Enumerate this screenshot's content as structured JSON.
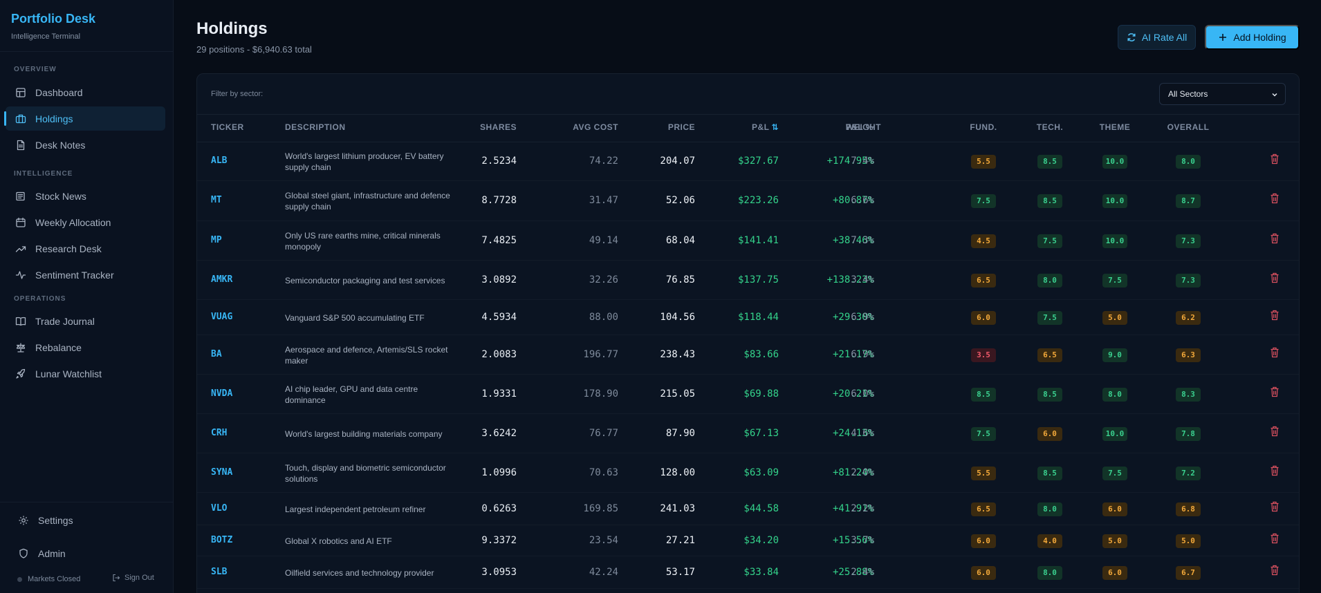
{
  "app": {
    "title": "Portfolio Desk",
    "subtitle": "Intelligence Terminal"
  },
  "sidebar": {
    "sections": [
      {
        "label": "OVERVIEW",
        "items": [
          {
            "label": "Dashboard",
            "icon": "grid-icon",
            "active": false
          },
          {
            "label": "Holdings",
            "icon": "briefcase-icon",
            "active": true
          },
          {
            "label": "Desk Notes",
            "icon": "document-icon",
            "active": false
          }
        ]
      },
      {
        "label": "INTELLIGENCE",
        "items": [
          {
            "label": "Stock News",
            "icon": "newspaper-icon",
            "active": false
          },
          {
            "label": "Weekly Allocation",
            "icon": "calendar-icon",
            "active": false
          },
          {
            "label": "Research Desk",
            "icon": "trend-icon",
            "active": false
          },
          {
            "label": "Sentiment Tracker",
            "icon": "pulse-icon",
            "active": false
          }
        ]
      },
      {
        "label": "OPERATIONS",
        "items": [
          {
            "label": "Trade Journal",
            "icon": "book-icon",
            "active": false
          },
          {
            "label": "Rebalance",
            "icon": "scale-icon",
            "active": false
          },
          {
            "label": "Lunar Watchlist",
            "icon": "rocket-icon",
            "active": false
          }
        ]
      }
    ],
    "settings_label": "Settings",
    "admin_label": "Admin",
    "market_status": "Markets Closed",
    "signout_label": "Sign Out"
  },
  "header": {
    "title": "Holdings",
    "subtitle": "29 positions - $6,940.63 total",
    "rate_button": "AI Rate All",
    "add_button": "Add Holding"
  },
  "filter": {
    "label": "Filter by sector:",
    "selected": "All Sectors"
  },
  "table": {
    "columns": {
      "ticker": "TICKER",
      "description": "DESCRIPTION",
      "shares": "SHARES",
      "avg_cost": "AVG COST",
      "price": "PRICE",
      "pl": "P&L",
      "pl_pct": "P&L %",
      "weight": "WEIGHT",
      "fund": "FUND.",
      "tech": "TECH.",
      "theme": "THEME",
      "overall": "OVERALL"
    },
    "colors": {
      "good": "#3ad08f",
      "mid": "#f3a93a",
      "bad": "#f0596a"
    },
    "rows": [
      {
        "ticker": "ALB",
        "desc": "World's largest lithium producer, EV battery supply chain",
        "shares": "2.5234",
        "avg": "74.22",
        "price": "204.07",
        "pl": "$327.67",
        "plp": "+174.95%",
        "weight": "7.4%",
        "fund": "5.5",
        "tech": "8.5",
        "theme": "10.0",
        "overall": "8.0"
      },
      {
        "ticker": "MT",
        "desc": "Global steel giant, infrastructure and defence supply chain",
        "shares": "8.7728",
        "avg": "31.47",
        "price": "52.06",
        "pl": "$223.26",
        "plp": "+80.87%",
        "weight": "6.6%",
        "fund": "7.5",
        "tech": "8.5",
        "theme": "10.0",
        "overall": "8.7"
      },
      {
        "ticker": "MP",
        "desc": "Only US rare earths mine, critical minerals monopoly",
        "shares": "7.4825",
        "avg": "49.14",
        "price": "68.04",
        "pl": "$141.41",
        "plp": "+38.46%",
        "weight": "7.3%",
        "fund": "4.5",
        "tech": "7.5",
        "theme": "10.0",
        "overall": "7.3"
      },
      {
        "ticker": "AMKR",
        "desc": "Semiconductor packaging and test services",
        "shares": "3.0892",
        "avg": "32.26",
        "price": "76.85",
        "pl": "$137.75",
        "plp": "+138.23%",
        "weight": "3.4%",
        "fund": "6.5",
        "tech": "8.0",
        "theme": "7.5",
        "overall": "7.3"
      },
      {
        "ticker": "VUAG",
        "desc": "Vanguard S&P 500 accumulating ETF",
        "shares": "4.5934",
        "avg": "88.00",
        "price": "104.56",
        "pl": "$118.44",
        "plp": "+29.30%",
        "weight": "6.9%",
        "fund": "6.0",
        "tech": "7.5",
        "theme": "5.0",
        "overall": "6.2"
      },
      {
        "ticker": "BA",
        "desc": "Aerospace and defence, Artemis/SLS rocket maker",
        "shares": "2.0083",
        "avg": "196.77",
        "price": "238.43",
        "pl": "$83.66",
        "plp": "+21.17%",
        "weight": "6.9%",
        "fund": "3.5",
        "tech": "6.5",
        "theme": "9.0",
        "overall": "6.3"
      },
      {
        "ticker": "NVDA",
        "desc": "AI chip leader, GPU and data centre dominance",
        "shares": "1.9331",
        "avg": "178.90",
        "price": "215.05",
        "pl": "$69.88",
        "plp": "+20.21%",
        "weight": "6.0%",
        "fund": "8.5",
        "tech": "8.5",
        "theme": "8.0",
        "overall": "8.3"
      },
      {
        "ticker": "CRH",
        "desc": "World's largest building materials company",
        "shares": "3.6242",
        "avg": "76.77",
        "price": "87.90",
        "pl": "$67.13",
        "plp": "+24.13%",
        "weight": "4.6%",
        "fund": "7.5",
        "tech": "6.0",
        "theme": "10.0",
        "overall": "7.8"
      },
      {
        "ticker": "SYNA",
        "desc": "Touch, display and biometric semiconductor solutions",
        "shares": "1.0996",
        "avg": "70.63",
        "price": "128.00",
        "pl": "$63.09",
        "plp": "+81.24%",
        "weight": "2.0%",
        "fund": "5.5",
        "tech": "8.5",
        "theme": "7.5",
        "overall": "7.2"
      },
      {
        "ticker": "VLO",
        "desc": "Largest independent petroleum refiner",
        "shares": "0.6263",
        "avg": "169.85",
        "price": "241.03",
        "pl": "$44.58",
        "plp": "+41.91%",
        "weight": "2.2%",
        "fund": "6.5",
        "tech": "8.0",
        "theme": "6.0",
        "overall": "6.8"
      },
      {
        "ticker": "BOTZ",
        "desc": "Global X robotics and AI ETF",
        "shares": "9.3372",
        "avg": "23.54",
        "price": "27.21",
        "pl": "$34.20",
        "plp": "+15.56%",
        "weight": "3.7%",
        "fund": "6.0",
        "tech": "4.0",
        "theme": "5.0",
        "overall": "5.0"
      },
      {
        "ticker": "SLB",
        "desc": "Oilfield services and technology provider",
        "shares": "3.0953",
        "avg": "42.24",
        "price": "53.17",
        "pl": "$33.84",
        "plp": "+25.88%",
        "weight": "2.4%",
        "fund": "6.0",
        "tech": "8.0",
        "theme": "6.0",
        "overall": "6.7"
      }
    ]
  }
}
